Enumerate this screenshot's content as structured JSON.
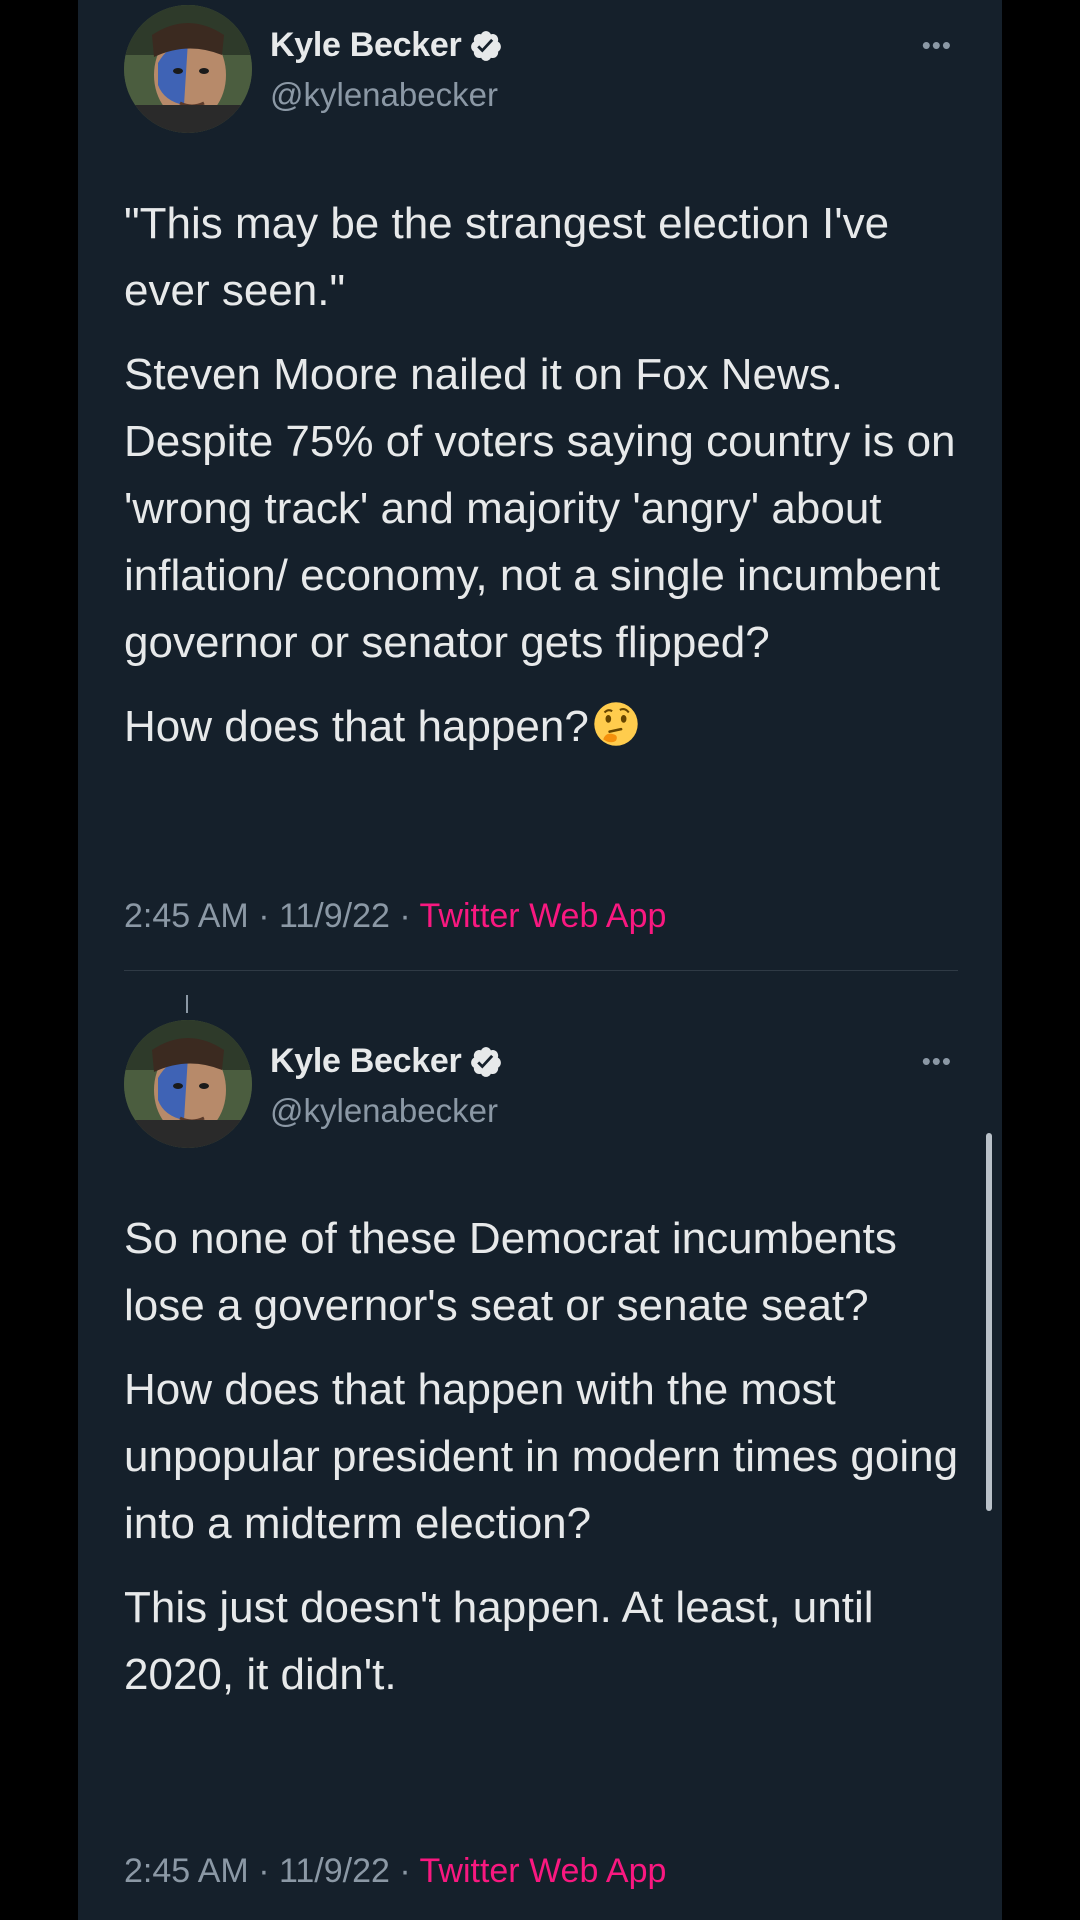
{
  "tweets": [
    {
      "author": {
        "name": "Kyle Becker",
        "handle": "@kylenabecker",
        "verified_icon": "verified-badge-icon",
        "avatar": "profile-avatar"
      },
      "more_label": "•••",
      "paragraphs": [
        "\"This may be the strangest election I've ever seen.\"",
        "Steven Moore nailed it on Fox News. Despite 75% of voters saying country is on 'wrong track' and majority 'angry' about inflation/ economy, not a single incumbent governor or senator gets flipped?",
        "How does that happen?"
      ],
      "emoji": "thinking-face-emoji",
      "time": "2:45 AM",
      "sep1": " · ",
      "date": "11/9/22",
      "sep2": " · ",
      "source": "Twitter Web App"
    },
    {
      "author": {
        "name": "Kyle Becker",
        "handle": "@kylenabecker",
        "verified_icon": "verified-badge-icon",
        "avatar": "profile-avatar"
      },
      "more_label": "•••",
      "paragraphs": [
        "So none of these Democrat incumbents lose a governor's seat or senate seat?",
        "How does that happen with the most unpopular president in modern times going into a midterm election?",
        "This just doesn't happen. At least, until 2020, it didn't."
      ],
      "time": "2:45 AM",
      "sep1": " · ",
      "date": "11/9/22",
      "sep2": " · ",
      "source": "Twitter Web App"
    }
  ],
  "colors": {
    "background": "#15202b",
    "text": "#e7e9ea",
    "secondary": "#8b98a5",
    "source_link": "#f91880",
    "verified": "#1d9bf0"
  }
}
